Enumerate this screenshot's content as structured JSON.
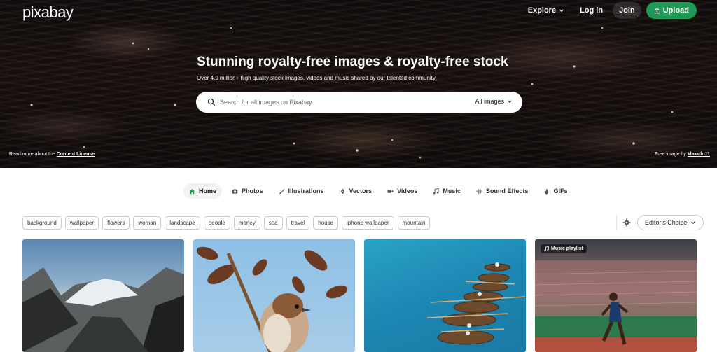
{
  "header": {
    "logo": "pixabay",
    "explore_label": "Explore",
    "login_label": "Log in",
    "join_label": "Join",
    "upload_label": "Upload"
  },
  "hero": {
    "title": "Stunning royalty-free images & royalty-free stock",
    "subtitle": "Over 4.9 million+ high quality stock images, videos and music shared by our talented community.",
    "license_text": "Read more about the ",
    "license_link": "Content License",
    "credit_text": "Free image by ",
    "credit_author": "khoado11"
  },
  "search": {
    "placeholder": "Search for all images on Pixabay",
    "scope_label": "All images"
  },
  "tabs": [
    {
      "label": "Home",
      "icon": "home-icon",
      "active": true
    },
    {
      "label": "Photos",
      "icon": "camera-icon"
    },
    {
      "label": "Illustrations",
      "icon": "brush-icon"
    },
    {
      "label": "Vectors",
      "icon": "pen-icon"
    },
    {
      "label": "Videos",
      "icon": "video-icon"
    },
    {
      "label": "Music",
      "icon": "music-icon"
    },
    {
      "label": "Sound Effects",
      "icon": "waveform-icon"
    },
    {
      "label": "GIFs",
      "icon": "fire-icon"
    }
  ],
  "tags": [
    "background",
    "wallpaper",
    "flowers",
    "woman",
    "landscape",
    "people",
    "money",
    "sea",
    "travel",
    "house",
    "iphone wallpaper",
    "mountain"
  ],
  "sort": {
    "label": "Editor's Choice"
  },
  "gallery": {
    "playlist_badge": "Music playlist"
  },
  "colors": {
    "accent": "#1e9a55",
    "text": "#333333"
  }
}
